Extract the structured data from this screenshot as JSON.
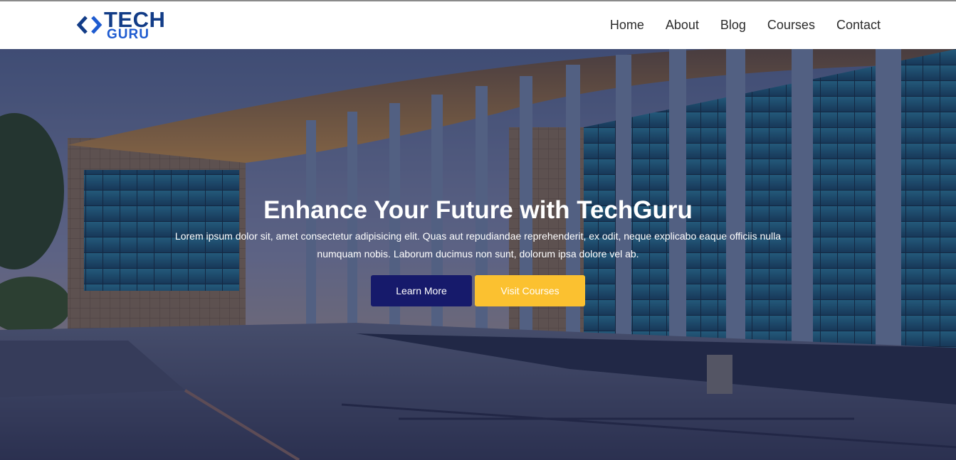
{
  "logo": {
    "line1": "TECH",
    "line2": "GURU"
  },
  "nav": [
    "Home",
    "About",
    "Blog",
    "Courses",
    "Contact"
  ],
  "hero": {
    "title": "Enhance Your Future with TechGuru",
    "text": "Lorem ipsum dolor sit, amet consectetur adipisicing elit. Quas aut repudiandae reprehenderit, ex odit, neque explicabo eaque officiis nulla numquam nobis. Laborum ducimus non sunt, dolorum ipsa dolore vel ab.",
    "primary_button": "Learn More",
    "secondary_button": "Visit Courses"
  },
  "colors": {
    "brand_dark": "#123c87",
    "brand_light": "#1e5bd0",
    "primary_button": "#161a6b",
    "secondary_button": "#fbc130"
  }
}
